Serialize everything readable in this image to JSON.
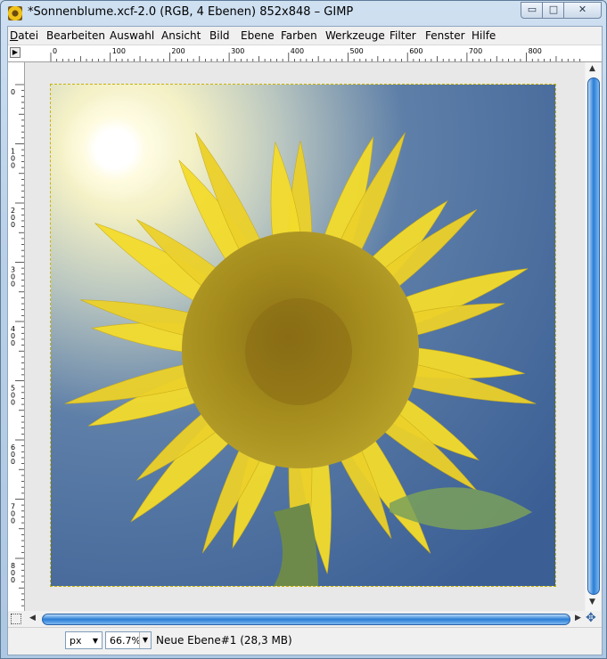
{
  "window": {
    "title": "*Sonnenblume.xcf-2.0 (RGB, 4 Ebenen) 852x848 – GIMP",
    "minimize": "▭",
    "maximize": "□",
    "close": "✕"
  },
  "menu": [
    {
      "id": "datei",
      "label": "Datei"
    },
    {
      "id": "bearbeiten",
      "label": "Bearbeiten"
    },
    {
      "id": "auswahl",
      "label": "Auswahl"
    },
    {
      "id": "ansicht",
      "label": "Ansicht"
    },
    {
      "id": "bild",
      "label": "Bild"
    },
    {
      "id": "ebene",
      "label": "Ebene"
    },
    {
      "id": "farben",
      "label": "Farben"
    },
    {
      "id": "werkzeuge",
      "label": "Werkzeuge"
    },
    {
      "id": "filter",
      "label": "Filter"
    },
    {
      "id": "fenster",
      "label": "Fenster"
    },
    {
      "id": "hilfe",
      "label": "Hilfe"
    }
  ],
  "ruler": {
    "horizontal_labels": [
      "0",
      "100",
      "200",
      "300",
      "400",
      "500",
      "600",
      "700",
      "800"
    ],
    "vertical_labels": [
      "0",
      "100",
      "200",
      "300",
      "400",
      "500",
      "600",
      "700",
      "800"
    ]
  },
  "status": {
    "unit": "px",
    "zoom": "66.7%",
    "text": "Neue Ebene#1 (28,3 MB)"
  },
  "icons": {
    "app": "gimp-icon",
    "navigate": "navigate-icon"
  }
}
